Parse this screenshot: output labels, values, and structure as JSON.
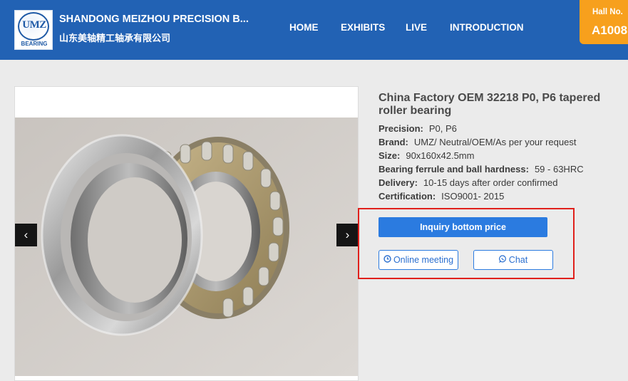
{
  "header": {
    "logo_text": "UMZ",
    "logo_subtext": "BEARING",
    "company_name": "SHANDONG MEIZHOU PRECISION B...",
    "company_name_cn": "山东美轴精工轴承有限公司",
    "nav": [
      "HOME",
      "EXHIBITS",
      "LIVE",
      "INTRODUCTION"
    ],
    "hall_label": "Hall No.",
    "hall_value": "A1008"
  },
  "gallery": {
    "prev_icon": "chevron-left-icon",
    "next_icon": "chevron-right-icon",
    "prev_glyph": "‹",
    "next_glyph": "›"
  },
  "product": {
    "title": "China Factory OEM 32218 P0, P6 tapered roller bearing",
    "specs": [
      {
        "label": "Precision:",
        "value": "P0, P6"
      },
      {
        "label": "Brand:",
        "value": "UMZ/ Neutral/OEM/As per your request"
      },
      {
        "label": "Size:",
        "value": "90x160x42.5mm"
      },
      {
        "label": "Bearing ferrule and ball hardness:",
        "value": "59 - 63HRC"
      },
      {
        "label": "Delivery:",
        "value": "10-15 days after order confirmed"
      },
      {
        "label": "Certification:",
        "value": "ISO9001- 2015"
      }
    ]
  },
  "actions": {
    "inquiry_label": "Inquiry bottom price",
    "meeting_label": "Online meeting",
    "meeting_icon": "clock-icon",
    "chat_label": "Chat",
    "chat_icon": "whatsapp-icon"
  },
  "colors": {
    "header_bg": "#2262b4",
    "hall_badge": "#f7a01d",
    "primary_button": "#2b7be0",
    "highlight_border": "#e0201b"
  }
}
